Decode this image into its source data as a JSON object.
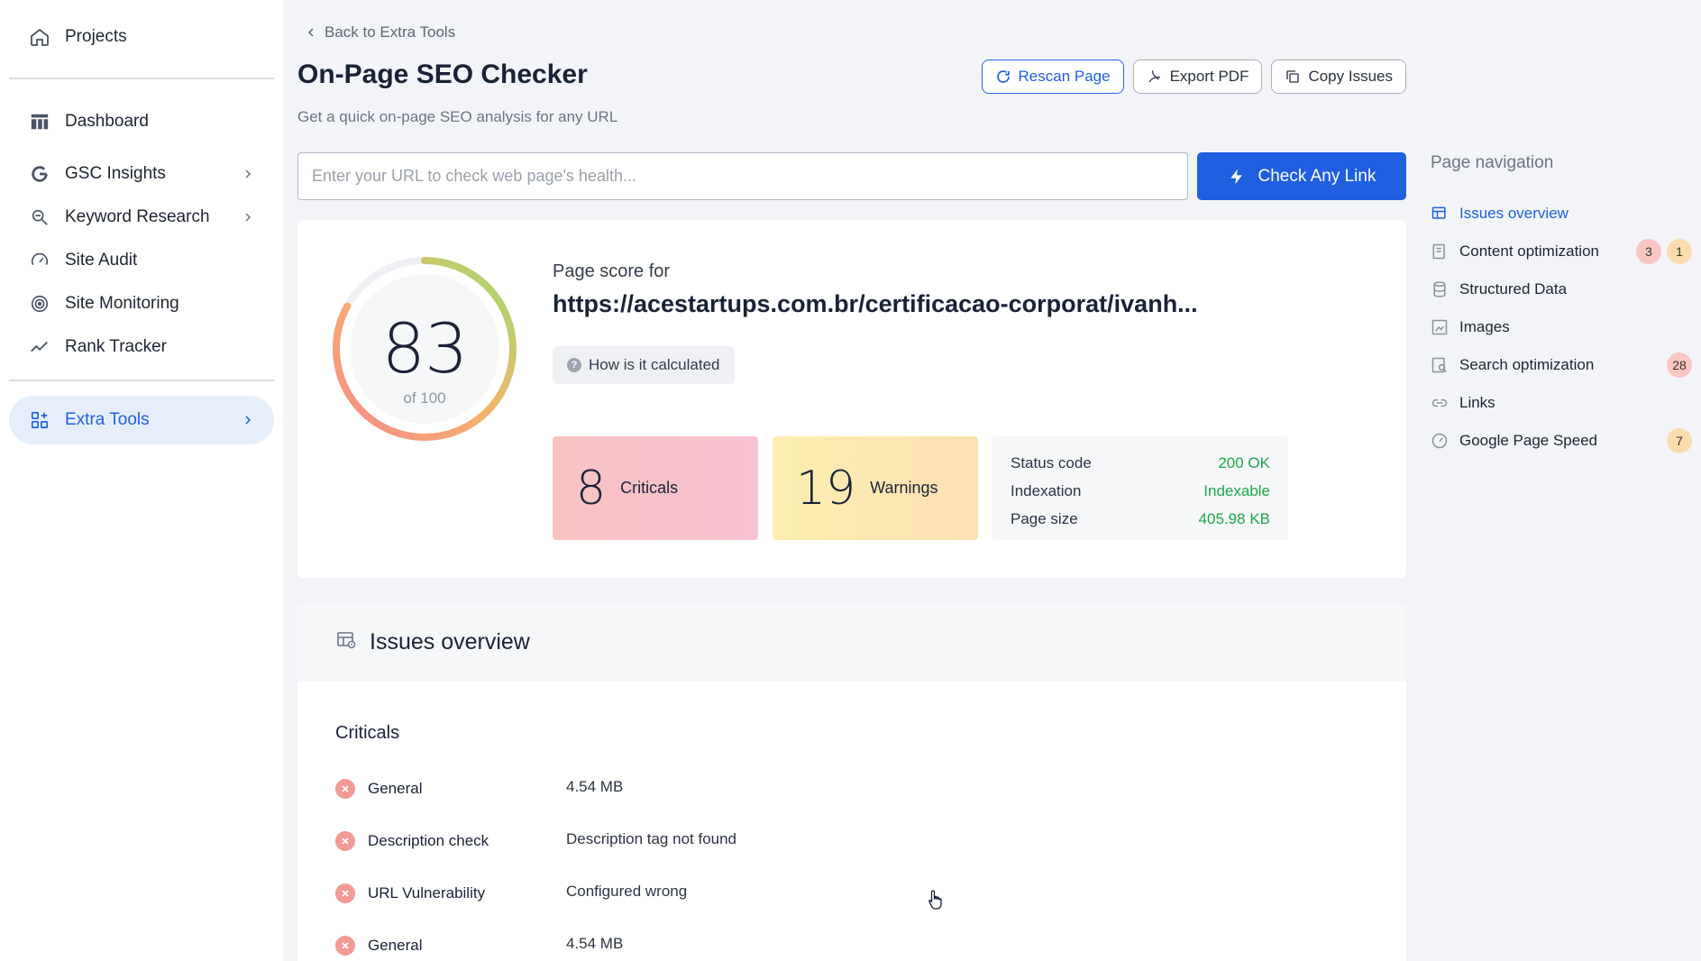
{
  "sidebar": {
    "projects": "Projects",
    "items": [
      {
        "label": "Dashboard",
        "icon": "dashboard-icon"
      },
      {
        "label": "GSC Insights",
        "icon": "google-icon",
        "has_submenu": true
      },
      {
        "label": "Keyword Research",
        "icon": "keyword-search-icon",
        "has_submenu": true
      },
      {
        "label": "Site Audit",
        "icon": "gauge-icon"
      },
      {
        "label": "Site Monitoring",
        "icon": "radar-icon"
      },
      {
        "label": "Rank Tracker",
        "icon": "trend-line-icon"
      }
    ],
    "extra_tools": "Extra Tools"
  },
  "header": {
    "back_label": "Back to Extra Tools",
    "title": "On-Page SEO Checker",
    "subtitle": "Get a quick on-page SEO analysis for any URL",
    "actions": {
      "rescan": "Rescan Page",
      "export": "Export PDF",
      "copy": "Copy Issues"
    }
  },
  "search": {
    "placeholder": "Enter your URL to check web page's health...",
    "value": "",
    "button": "Check Any Link"
  },
  "score": {
    "value": "83",
    "of_label": "of 100",
    "fraction": 0.83,
    "label": "Page score for",
    "url": "https://acestartups.com.br/certificacao-corporat/ivanh...",
    "how_label": "How is it calculated"
  },
  "counts": {
    "criticals_value": "8",
    "criticals_label": "Criticals",
    "warnings_value": "19",
    "warnings_label": "Warnings"
  },
  "status": [
    {
      "key": "Status code",
      "value": "200 OK"
    },
    {
      "key": "Indexation",
      "value": "Indexable"
    },
    {
      "key": "Page size",
      "value": "405.98 KB"
    }
  ],
  "issues": {
    "heading": "Issues overview",
    "criticals_heading": "Criticals",
    "rows": [
      {
        "name": "General",
        "value": "4.54 MB"
      },
      {
        "name": "Description check",
        "value": "Description tag not found"
      },
      {
        "name": "URL Vulnerability",
        "value": "Configured wrong"
      },
      {
        "name": "General",
        "value": "4.54 MB"
      }
    ]
  },
  "page_nav": {
    "title": "Page navigation",
    "items": [
      {
        "label": "Issues overview",
        "active": true
      },
      {
        "label": "Content optimization",
        "badge_red": "3",
        "badge_yellow": "1"
      },
      {
        "label": "Structured Data"
      },
      {
        "label": "Images"
      },
      {
        "label": "Search optimization",
        "badge_red": "28"
      },
      {
        "label": "Links"
      },
      {
        "label": "Google Page Speed",
        "badge_yellow": "7"
      }
    ]
  },
  "colors": {
    "accent": "#1f5fe0",
    "success": "#1fa64a",
    "critical": "#f29a95",
    "warning": "#fbdcae"
  }
}
